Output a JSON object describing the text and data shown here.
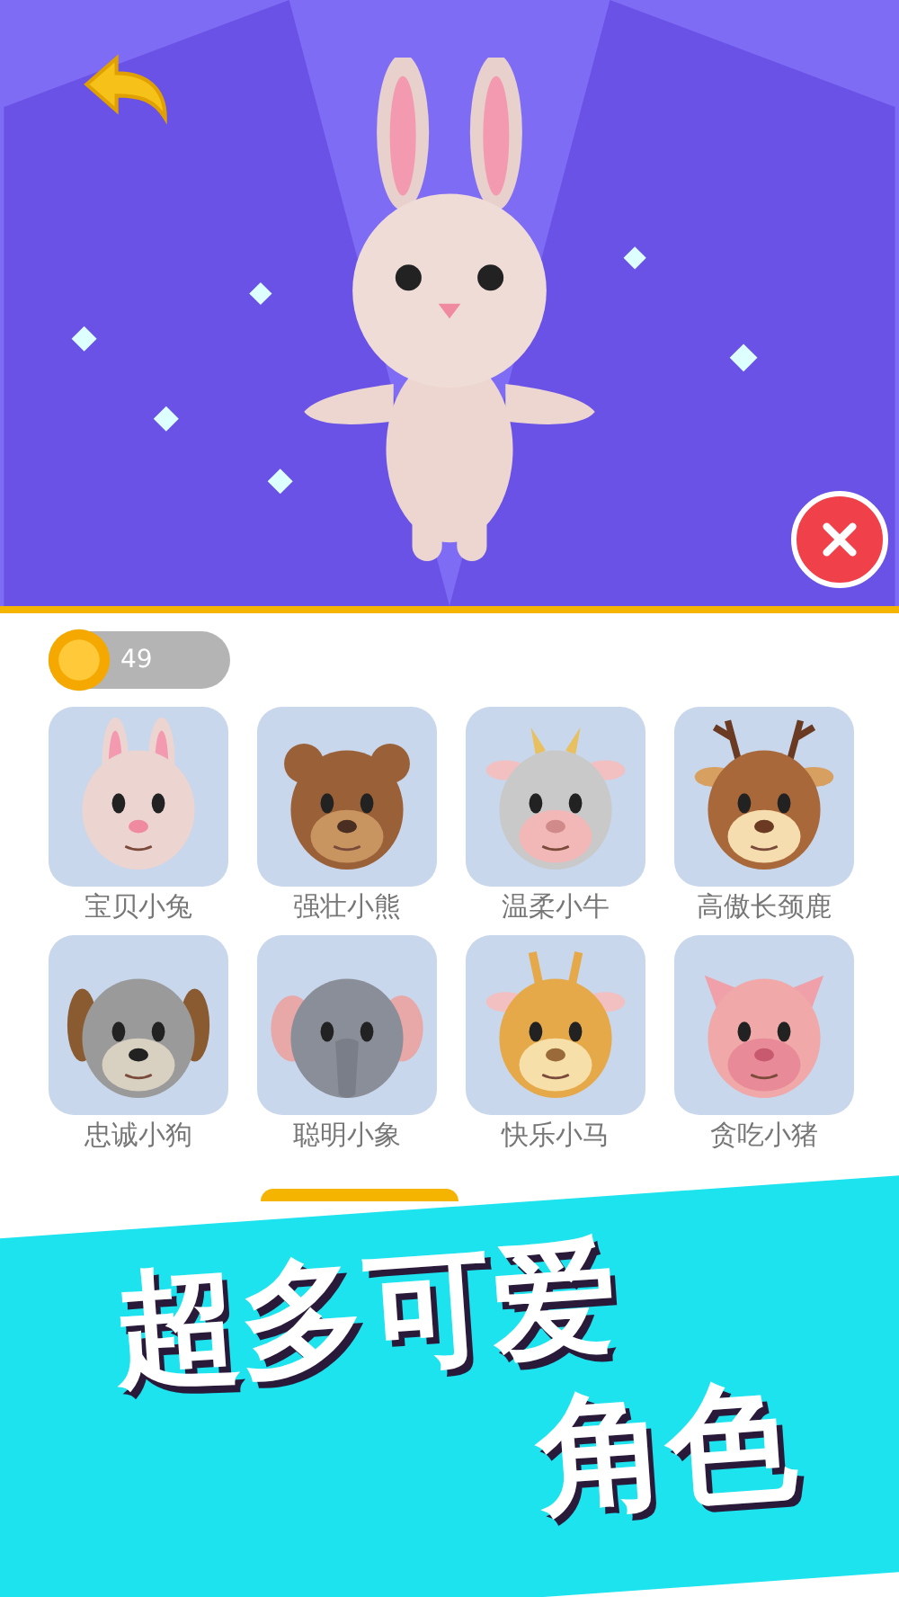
{
  "coins": {
    "amount": "49"
  },
  "characters": [
    {
      "name": "宝贝小兔",
      "kind": "rabbit"
    },
    {
      "name": "强壮小熊",
      "kind": "bear"
    },
    {
      "name": "温柔小牛",
      "kind": "cow"
    },
    {
      "name": "高傲长颈鹿",
      "kind": "deer"
    },
    {
      "name": "忠诚小狗",
      "kind": "dog"
    },
    {
      "name": "聪明小象",
      "kind": "elephant"
    },
    {
      "name": "快乐小马",
      "kind": "giraffe"
    },
    {
      "name": "贪吃小猪",
      "kind": "pig"
    }
  ],
  "banner": {
    "line_1": "超多可爱",
    "line_2": "角色"
  }
}
